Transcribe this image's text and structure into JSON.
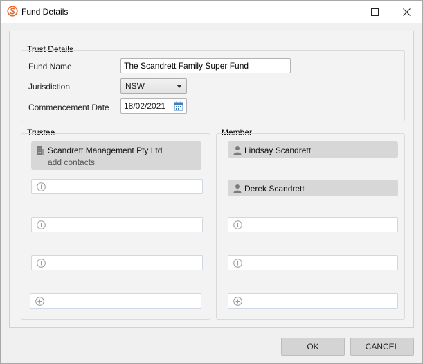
{
  "window": {
    "title": "Fund Details"
  },
  "trust_details": {
    "group_label": "Trust Details",
    "fund_name_label": "Fund Name",
    "fund_name_value": "The Scandrett Family Super Fund",
    "jurisdiction_label": "Jurisdiction",
    "jurisdiction_value": "NSW",
    "commencement_label": "Commencement Date",
    "commencement_value": "18/02/2021"
  },
  "trustee": {
    "group_label": "Trustee",
    "entries": [
      {
        "name": "Scandrett Management Pty Ltd",
        "link": "add contacts",
        "icon": "building-icon"
      }
    ]
  },
  "member": {
    "group_label": "Member",
    "entries": [
      {
        "name": "Lindsay Scandrett",
        "icon": "person-icon"
      },
      {
        "name": "Derek Scandrett",
        "icon": "person-icon"
      }
    ]
  },
  "footer": {
    "ok_label": "OK",
    "cancel_label": "CANCEL"
  },
  "colors": {
    "app_icon": "#e8692e",
    "card_bg": "#d7d7d7",
    "calendar_icon": "#3d7fc4"
  }
}
